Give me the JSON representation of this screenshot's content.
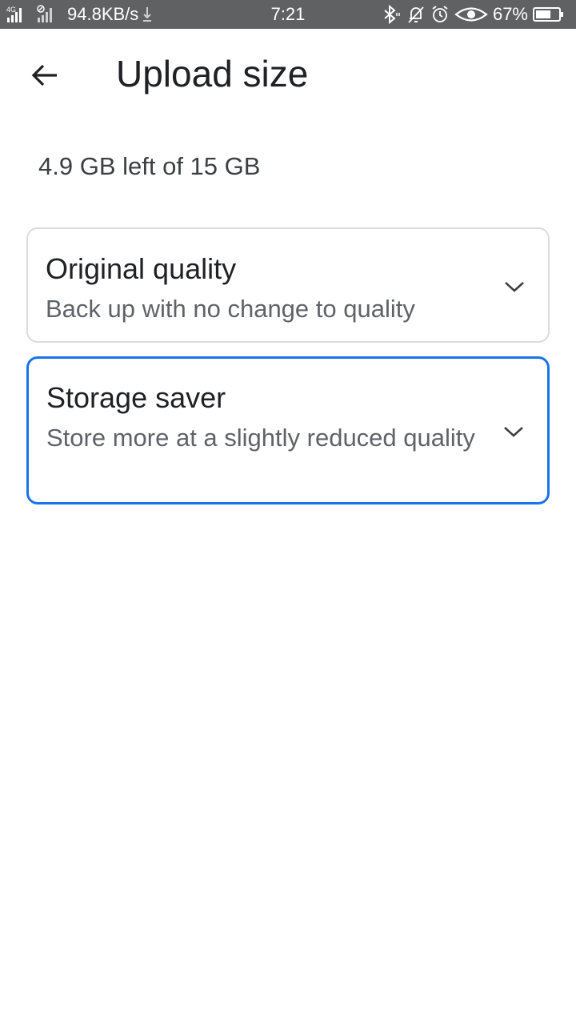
{
  "status_bar": {
    "network_type": "4G",
    "net_speed": "94.8KB/s",
    "time": "7:21",
    "battery_percent": "67%",
    "battery_level": 0.67,
    "icons": [
      "signal-icon",
      "download-icon",
      "bluetooth-icon",
      "mute-icon",
      "alarm-icon",
      "eye-icon",
      "battery-icon"
    ]
  },
  "app_bar": {
    "title": "Upload size",
    "back_icon": "arrow-back-icon"
  },
  "storage": {
    "summary": "4.9 GB left of 15 GB"
  },
  "options": [
    {
      "title": "Original quality",
      "subtitle": "Back up with no change to quality",
      "selected": false,
      "icon": "chevron-down-icon"
    },
    {
      "title": "Storage saver",
      "subtitle": "Store more at a slightly reduced quality",
      "selected": true,
      "icon": "chevron-down-icon"
    }
  ],
  "colors": {
    "accent": "#1a73e8",
    "status_bar_bg": "#5f6163",
    "card_border": "#dadce0",
    "subtitle_text": "#5f6368"
  }
}
